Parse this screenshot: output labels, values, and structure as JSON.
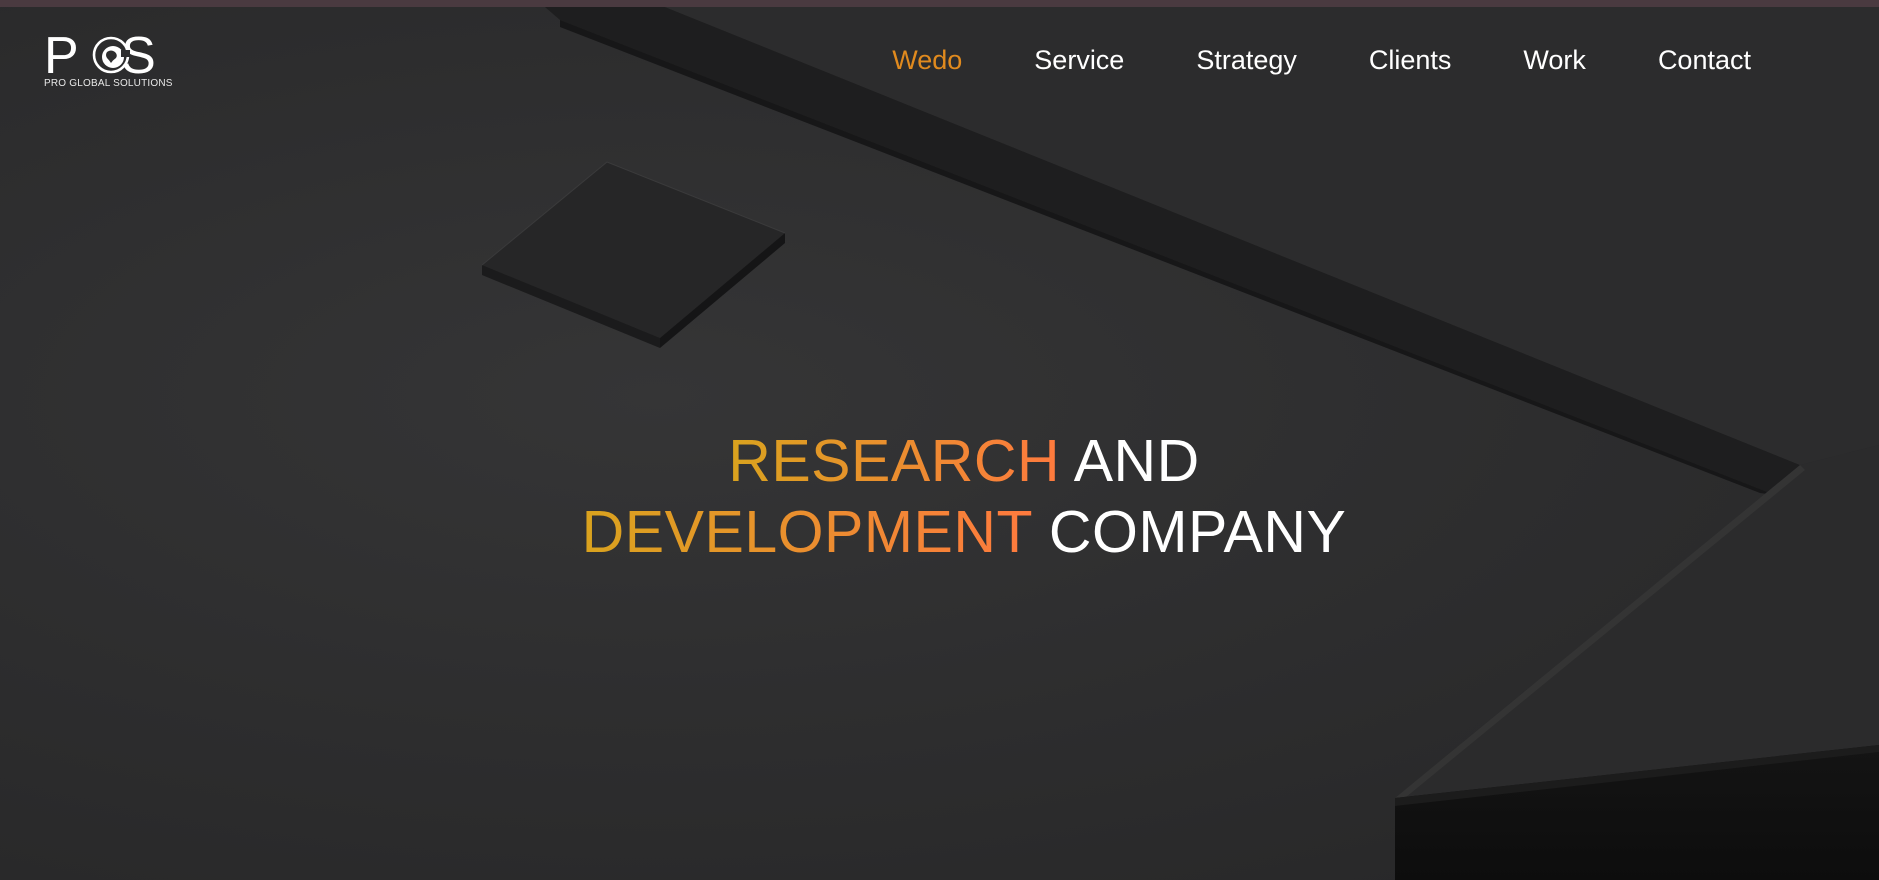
{
  "brand": {
    "logo_text": "PGS",
    "tagline": "PRO GLOBAL SOLUTIONS",
    "icon": "globe-icon"
  },
  "nav": {
    "items": [
      {
        "label": "Wedo",
        "active": true
      },
      {
        "label": "Service",
        "active": false
      },
      {
        "label": "Strategy",
        "active": false
      },
      {
        "label": "Clients",
        "active": false
      },
      {
        "label": "Work",
        "active": false
      },
      {
        "label": "Contact",
        "active": false
      }
    ]
  },
  "hero": {
    "line1_accent": "RESEARCH",
    "line1_plain": "AND",
    "line2_accent": "DEVELOPMENT",
    "line2_plain": "COMPANY"
  },
  "colors": {
    "background": "#2e2e2f",
    "accent": "#e08a1e",
    "gradient_start": "#d9a31e",
    "gradient_end": "#ff7a3e",
    "text": "#ffffff"
  }
}
